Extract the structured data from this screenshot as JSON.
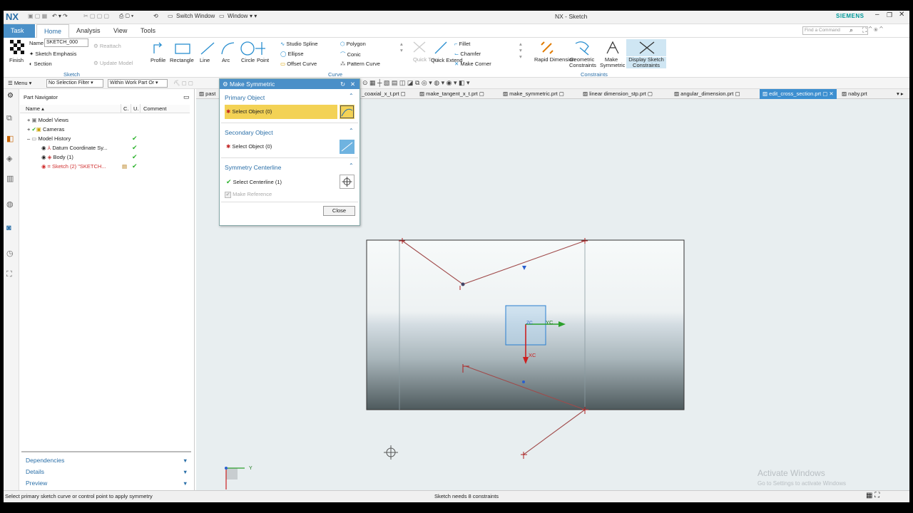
{
  "app": {
    "logo": "NX",
    "title": "NX - Sketch",
    "brand": "SIEMENS",
    "switch_window": "Switch Window",
    "window": "Window",
    "find_placeholder": "Find a Command"
  },
  "ribbon_tabs": [
    "Task",
    "Home",
    "Analysis",
    "View",
    "Tools"
  ],
  "ribbon": {
    "finish": "Finish",
    "name_label": "Name",
    "name_value": "SKETCH_000",
    "sketch_emphasis": "Sketch Emphasis",
    "section": "Section",
    "reattach": "Reattach",
    "update_model": "Update Model",
    "group_sketch": "Sketch",
    "profile": "Profile",
    "rectangle": "Rectangle",
    "line": "Line",
    "arc": "Arc",
    "circle": "Circle",
    "point": "Point",
    "studio_spline": "Studio Spline",
    "ellipse": "Ellipse",
    "offset_curve": "Offset Curve",
    "polygon": "Polygon",
    "conic": "Conic",
    "pattern_curve": "Pattern Curve",
    "quick_trim": "Quick Trim",
    "quick_extend": "Quick Extend",
    "fillet": "Fillet",
    "chamfer": "Chamfer",
    "make_corner": "Make Corner",
    "group_curve": "Curve",
    "rapid_dimension": "Rapid Dimension",
    "geometric_constraints": "Geometric Constraints",
    "make_symmetric": "Make Symmetric",
    "display_sketch_constraints": "Display Sketch Constraints",
    "group_constraints": "Constraints"
  },
  "toolbar2": {
    "menu": "Menu",
    "filter": "No Selection Filter",
    "scope": "Within Work Part Or"
  },
  "file_tabs": [
    "past",
    "_coaxial_x_t.prt",
    "make_tangent_x_t.prt",
    "make_symmetric.prt",
    "linear dimension_stp.prt",
    "angular_dimension.prt",
    "edit_cross_section.prt",
    "naby.prt"
  ],
  "navigator": {
    "title": "Part Navigator",
    "col_name": "Name",
    "col_c": "C.",
    "col_u": "U.",
    "col_comment": "Comment",
    "rows": [
      "Model Views",
      "Cameras",
      "Model History",
      "Datum Coordinate Sy...",
      "Body (1)",
      "Sketch (2) \"SKETCH..."
    ],
    "panels": [
      "Dependencies",
      "Details",
      "Preview"
    ]
  },
  "dialog": {
    "title": "Make Symmetric",
    "primary_header": "Primary Object",
    "primary_select": "Select Object (0)",
    "secondary_header": "Secondary Object",
    "secondary_select": "Select Object (0)",
    "centerline_header": "Symmetry Centerline",
    "centerline_select": "Select Centerline (1)",
    "make_reference": "Make Reference",
    "close": "Close"
  },
  "canvas": {
    "yc": "YC",
    "xc": "XC",
    "zc": "ZC",
    "triad_y": "Y",
    "triad_x": "X",
    "watermark1": "Activate Windows",
    "watermark2": "Go to Settings to activate Windows"
  },
  "status": {
    "left": "Select primary sketch curve or control point to apply symmetry",
    "center": "Sketch needs 8 constraints"
  }
}
